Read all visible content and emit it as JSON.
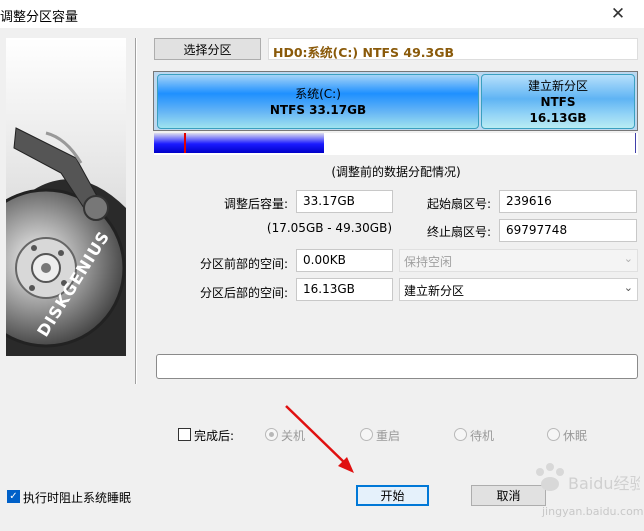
{
  "window": {
    "title": "调整分区容量",
    "close_glyph": "✕"
  },
  "left_image": {
    "brand_text": "DISKGENIUS"
  },
  "top": {
    "select_partition_label": "选择分区",
    "disk_info": "HD0:系统(C:) NTFS 49.3GB"
  },
  "partitions": [
    {
      "name": "系统(C:)",
      "detail": "NTFS 33.17GB"
    },
    {
      "name": "建立新分区",
      "fs": "NTFS",
      "size": "16.13GB"
    }
  ],
  "allocation_caption": "(调整前的数据分配情况)",
  "form": {
    "new_size_label": "调整后容量:",
    "new_size_value": "33.17GB",
    "range_text": "(17.05GB - 49.30GB)",
    "start_sector_label": "起始扇区号:",
    "start_sector_value": "239616",
    "end_sector_label": "终止扇区号:",
    "end_sector_value": "69797748",
    "space_before_label": "分区前部的空间:",
    "space_before_value": "0.00KB",
    "space_before_option": "保持空闲",
    "space_after_label": "分区后部的空间:",
    "space_after_value": "16.13GB",
    "space_after_option": "建立新分区"
  },
  "after_done": {
    "checkbox_label": "完成后:",
    "options": [
      "关机",
      "重启",
      "待机",
      "休眠"
    ]
  },
  "prevent_sleep_label": "执行时阻止系统睡眠",
  "buttons": {
    "start": "开始",
    "cancel": "取消"
  },
  "watermark": "Baidu经验",
  "watermark_url": "jingyan.baidu.com",
  "colors": {
    "disk_info_text": "#8a5a0a",
    "partition_blue": "#1e90ff",
    "alloc_blue": "#0000c8",
    "arrow_red": "#e01010"
  },
  "icons": {
    "close": "close-icon",
    "dropdown": "chevron-down-icon"
  }
}
